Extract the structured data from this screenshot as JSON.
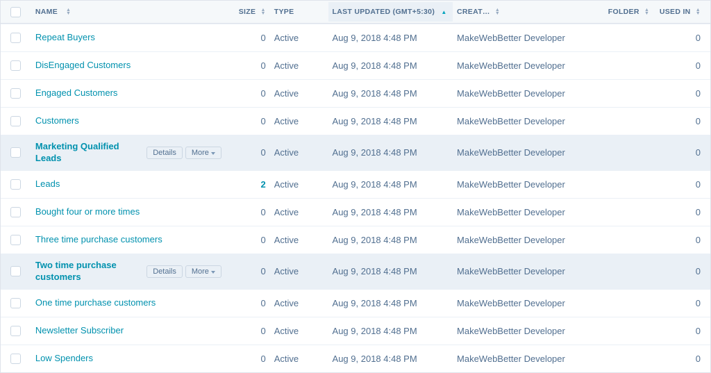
{
  "columns": {
    "name": "NAME",
    "size": "SIZE",
    "type": "TYPE",
    "last_updated": "LAST UPDATED (GMT+5:30)",
    "creator": "CREAT…",
    "folder": "FOLDER",
    "used_in": "USED IN"
  },
  "hover_actions": {
    "details": "Details",
    "more": "More"
  },
  "rows": [
    {
      "name": "Repeat Buyers",
      "size": "0",
      "size_is_link": false,
      "type": "Active",
      "updated": "Aug 9, 2018 4:48 PM",
      "creator": "MakeWebBetter Developer",
      "folder": "",
      "used_in": "0",
      "hovered": false
    },
    {
      "name": "DisEngaged Customers",
      "size": "0",
      "size_is_link": false,
      "type": "Active",
      "updated": "Aug 9, 2018 4:48 PM",
      "creator": "MakeWebBetter Developer",
      "folder": "",
      "used_in": "0",
      "hovered": false
    },
    {
      "name": "Engaged Customers",
      "size": "0",
      "size_is_link": false,
      "type": "Active",
      "updated": "Aug 9, 2018 4:48 PM",
      "creator": "MakeWebBetter Developer",
      "folder": "",
      "used_in": "0",
      "hovered": false
    },
    {
      "name": "Customers",
      "size": "0",
      "size_is_link": false,
      "type": "Active",
      "updated": "Aug 9, 2018 4:48 PM",
      "creator": "MakeWebBetter Developer",
      "folder": "",
      "used_in": "0",
      "hovered": false
    },
    {
      "name": "Marketing Qualified Leads",
      "size": "0",
      "size_is_link": false,
      "type": "Active",
      "updated": "Aug 9, 2018 4:48 PM",
      "creator": "MakeWebBetter Developer",
      "folder": "",
      "used_in": "0",
      "hovered": true
    },
    {
      "name": "Leads",
      "size": "2",
      "size_is_link": true,
      "type": "Active",
      "updated": "Aug 9, 2018 4:48 PM",
      "creator": "MakeWebBetter Developer",
      "folder": "",
      "used_in": "0",
      "hovered": false
    },
    {
      "name": "Bought four or more times",
      "size": "0",
      "size_is_link": false,
      "type": "Active",
      "updated": "Aug 9, 2018 4:48 PM",
      "creator": "MakeWebBetter Developer",
      "folder": "",
      "used_in": "0",
      "hovered": false
    },
    {
      "name": "Three time purchase customers",
      "size": "0",
      "size_is_link": false,
      "type": "Active",
      "updated": "Aug 9, 2018 4:48 PM",
      "creator": "MakeWebBetter Developer",
      "folder": "",
      "used_in": "0",
      "hovered": false
    },
    {
      "name": "Two time purchase customers",
      "size": "0",
      "size_is_link": false,
      "type": "Active",
      "updated": "Aug 9, 2018 4:48 PM",
      "creator": "MakeWebBetter Developer",
      "folder": "",
      "used_in": "0",
      "hovered": true
    },
    {
      "name": "One time purchase customers",
      "size": "0",
      "size_is_link": false,
      "type": "Active",
      "updated": "Aug 9, 2018 4:48 PM",
      "creator": "MakeWebBetter Developer",
      "folder": "",
      "used_in": "0",
      "hovered": false
    },
    {
      "name": "Newsletter Subscriber",
      "size": "0",
      "size_is_link": false,
      "type": "Active",
      "updated": "Aug 9, 2018 4:48 PM",
      "creator": "MakeWebBetter Developer",
      "folder": "",
      "used_in": "0",
      "hovered": false
    },
    {
      "name": "Low Spenders",
      "size": "0",
      "size_is_link": false,
      "type": "Active",
      "updated": "Aug 9, 2018 4:48 PM",
      "creator": "MakeWebBetter Developer",
      "folder": "",
      "used_in": "0",
      "hovered": false
    }
  ]
}
